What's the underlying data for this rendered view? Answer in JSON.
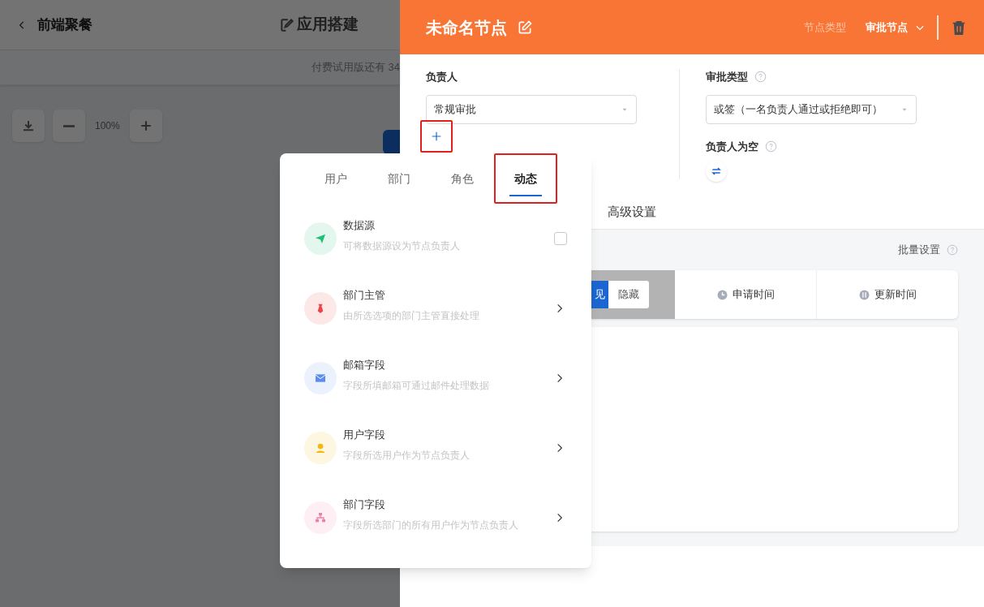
{
  "app": {
    "back_label": "前端聚餐",
    "title": "应用搭建",
    "trial_notice": "付费试用版还有 34",
    "zoom": "100%"
  },
  "drawer": {
    "node_name": "未命名节点",
    "node_type_label": "节点类型",
    "node_type": "审批节点",
    "owner": {
      "label": "负责人",
      "value": "常规审批",
      "add_highlighted": true
    },
    "approval_type": {
      "label": "审批类型",
      "value": "或签（一名负责人通过或拒绝即可）"
    },
    "empty_owner": {
      "label": "负责人为空"
    },
    "tabs": [
      {
        "label": "高级设置",
        "selected": false
      }
    ],
    "batch_label": "批量设置",
    "columns": [
      {
        "kind": "toggle",
        "visible_part": "见",
        "button": "隐藏"
      },
      {
        "kind": "time",
        "label": "申请时间"
      },
      {
        "kind": "update",
        "label": "更新时间"
      }
    ]
  },
  "popover": {
    "tabs": [
      {
        "label": "用户",
        "selected": false,
        "highlighted": false
      },
      {
        "label": "部门",
        "selected": false,
        "highlighted": false
      },
      {
        "label": "角色",
        "selected": false,
        "highlighted": false
      },
      {
        "label": "动态",
        "selected": true,
        "highlighted": true
      }
    ],
    "items": [
      {
        "kind": "checkbox",
        "color": "#1fbf75",
        "title": "数据源",
        "desc": "可将数据源设为节点负责人",
        "checked": false
      },
      {
        "kind": "arrow",
        "color": "#f04343",
        "title": "部门主管",
        "desc": "由所选选项的部门主管直接处理"
      },
      {
        "kind": "arrow",
        "color": "#5b8def",
        "title": "邮箱字段",
        "desc": "字段所填邮箱可通过邮件处理数据"
      },
      {
        "kind": "arrow",
        "color": "#f2b90c",
        "title": "用户字段",
        "desc": "字段所选用户作为节点负责人"
      },
      {
        "kind": "arrow",
        "color": "#f07fa8",
        "title": "部门字段",
        "desc": "字段所选部门的所有用户作为节点负责人"
      }
    ]
  }
}
